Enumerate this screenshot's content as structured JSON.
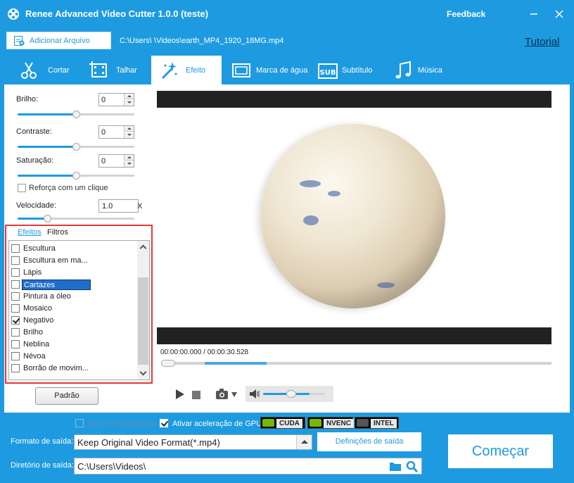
{
  "app": {
    "title": "Renee Advanced Video Cutter 1.0.0 (teste)",
    "feedback": "Feedback",
    "icons": {
      "logo": "film-reel-icon",
      "minimize": "minimize-icon",
      "close": "close-icon"
    }
  },
  "toolbar": {
    "add_file": "Adicionar Arquivo",
    "file_path": "C:\\Users\\      \\Videos\\earth_MP4_1920_18MG.mp4",
    "tutorial": "Tutorial"
  },
  "tabs": [
    {
      "label": "Cortar",
      "icon": "scissors-icon"
    },
    {
      "label": "Talhar",
      "icon": "crop-film-icon"
    },
    {
      "label": "Efeito",
      "icon": "magic-wand-icon",
      "active": true
    },
    {
      "label": "Marca de água",
      "icon": "watermark-frame-icon"
    },
    {
      "label": "Subtítulo",
      "icon": "subtitle-icon"
    },
    {
      "label": "Música",
      "icon": "music-note-icon"
    }
  ],
  "adjust": {
    "brightness": {
      "label": "Brilho:",
      "value": "0",
      "level": 0.5
    },
    "contrast": {
      "label": "Contraste:",
      "value": "0",
      "level": 0.5
    },
    "saturation": {
      "label": "Saturação:",
      "value": "0",
      "level": 0.5
    },
    "boost": {
      "label": "Reforça com um clique",
      "checked": false
    },
    "speed": {
      "label": "Velocidade:",
      "value": "1.0",
      "unit": "X",
      "level": 0.25
    }
  },
  "effects": {
    "tab_effects": "Efeitos",
    "tab_filters": "Filtros",
    "items": [
      {
        "label": "Escultura",
        "checked": false
      },
      {
        "label": "Escultura em ma...",
        "checked": false
      },
      {
        "label": "Lápis",
        "checked": false
      },
      {
        "label": "Cartazes",
        "checked": false,
        "selected": true
      },
      {
        "label": "Pintura a óleo",
        "checked": false
      },
      {
        "label": "Mosaico",
        "checked": false
      },
      {
        "label": "Negativo",
        "checked": true
      },
      {
        "label": "Brilho",
        "checked": false
      },
      {
        "label": "Neblina",
        "checked": false
      },
      {
        "label": "Névoa",
        "checked": false
      },
      {
        "label": "Borrão de movim...",
        "checked": false
      }
    ],
    "default_button": "Padrão"
  },
  "player": {
    "timecode": "00:00:00.000 / 00:00:30.528",
    "progress": 0.0,
    "buffered": 0.27,
    "volume": 0.75,
    "icons": {
      "play": "play-icon",
      "stop": "stop-icon",
      "snapshot": "camera-icon",
      "volume": "speaker-icon"
    }
  },
  "output": {
    "force_reencode": {
      "label": "forçar recodificação",
      "checked": false
    },
    "gpu_accel": {
      "label": "Ativar aceleração de GPU",
      "checked": true
    },
    "gpu_badges": [
      "CUDA",
      "NVENC",
      "INTEL"
    ],
    "format_label": "Formato de saída:",
    "format_value": "Keep Original Video Format(*.mp4)",
    "settings_button": "Definições de saída",
    "dir_label": "Diretório de saída:",
    "dir_value": "C:\\Users\\Videos\\",
    "start_button": "Começar"
  },
  "colors": {
    "accent": "#1e9be0",
    "highlight_border": "#e53935",
    "selection": "#1e6fcc"
  }
}
